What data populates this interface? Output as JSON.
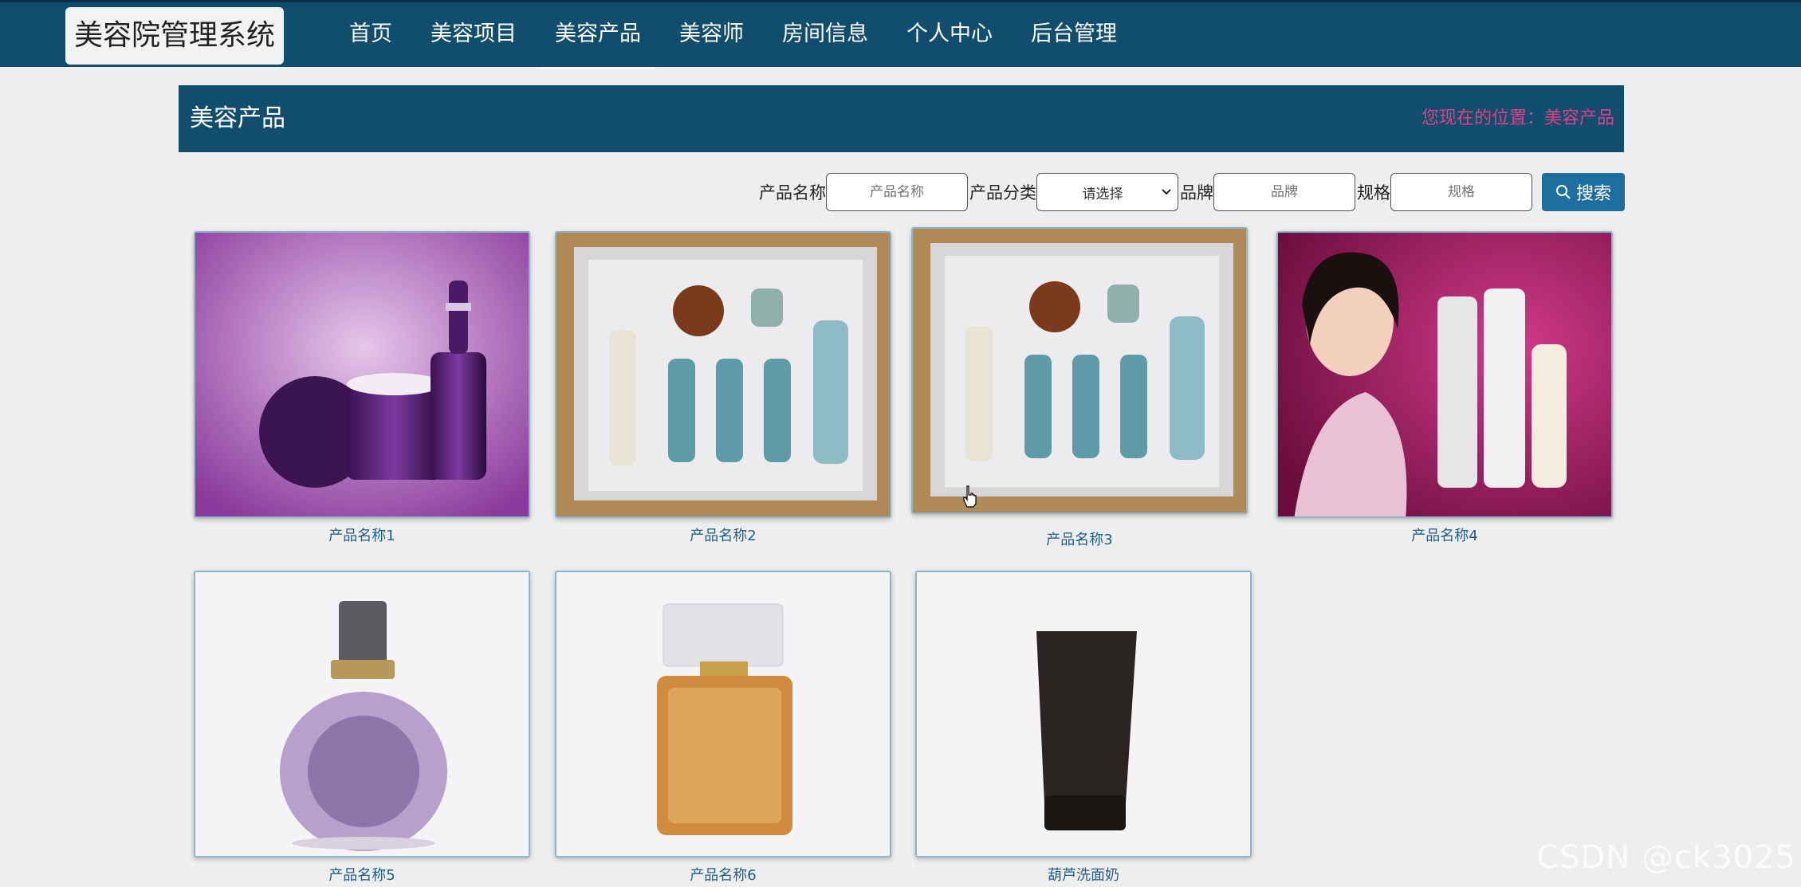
{
  "app": {
    "title": "美容院管理系统"
  },
  "nav": {
    "items": [
      {
        "label": "首页"
      },
      {
        "label": "美容项目"
      },
      {
        "label": "美容产品"
      },
      {
        "label": "美容师"
      },
      {
        "label": "房间信息"
      },
      {
        "label": "个人中心"
      },
      {
        "label": "后台管理"
      }
    ],
    "active_index": 2
  },
  "section": {
    "title": "美容产品",
    "breadcrumb_prefix": "您现在的位置：",
    "breadcrumb_current": "美容产品"
  },
  "search": {
    "name_label": "产品名称",
    "name_placeholder": "产品名称",
    "category_label": "产品分类",
    "category_selected": "请选择",
    "brand_label": "品牌",
    "brand_placeholder": "品牌",
    "spec_label": "规格",
    "spec_placeholder": "规格",
    "button_label": "搜索"
  },
  "products": [
    {
      "name": "产品名称1",
      "image": "purple-skincare-set"
    },
    {
      "name": "产品名称2",
      "image": "skincare-gift-box"
    },
    {
      "name": "产品名称3",
      "image": "skincare-gift-box"
    },
    {
      "name": "产品名称4",
      "image": "model-with-lotion-bottles"
    },
    {
      "name": "产品名称5",
      "image": "purple-perfume-bottle"
    },
    {
      "name": "产品名称6",
      "image": "amber-perfume-bottle"
    },
    {
      "name": "葫芦洗面奶",
      "image": "black-cleanser-tube"
    }
  ],
  "watermark": "CSDN @ck3025",
  "colors": {
    "nav_bg": "#114d6c",
    "breadcrumb": "#e0408a",
    "product_name": "#1d5f86",
    "button": "#1e6f9f"
  }
}
